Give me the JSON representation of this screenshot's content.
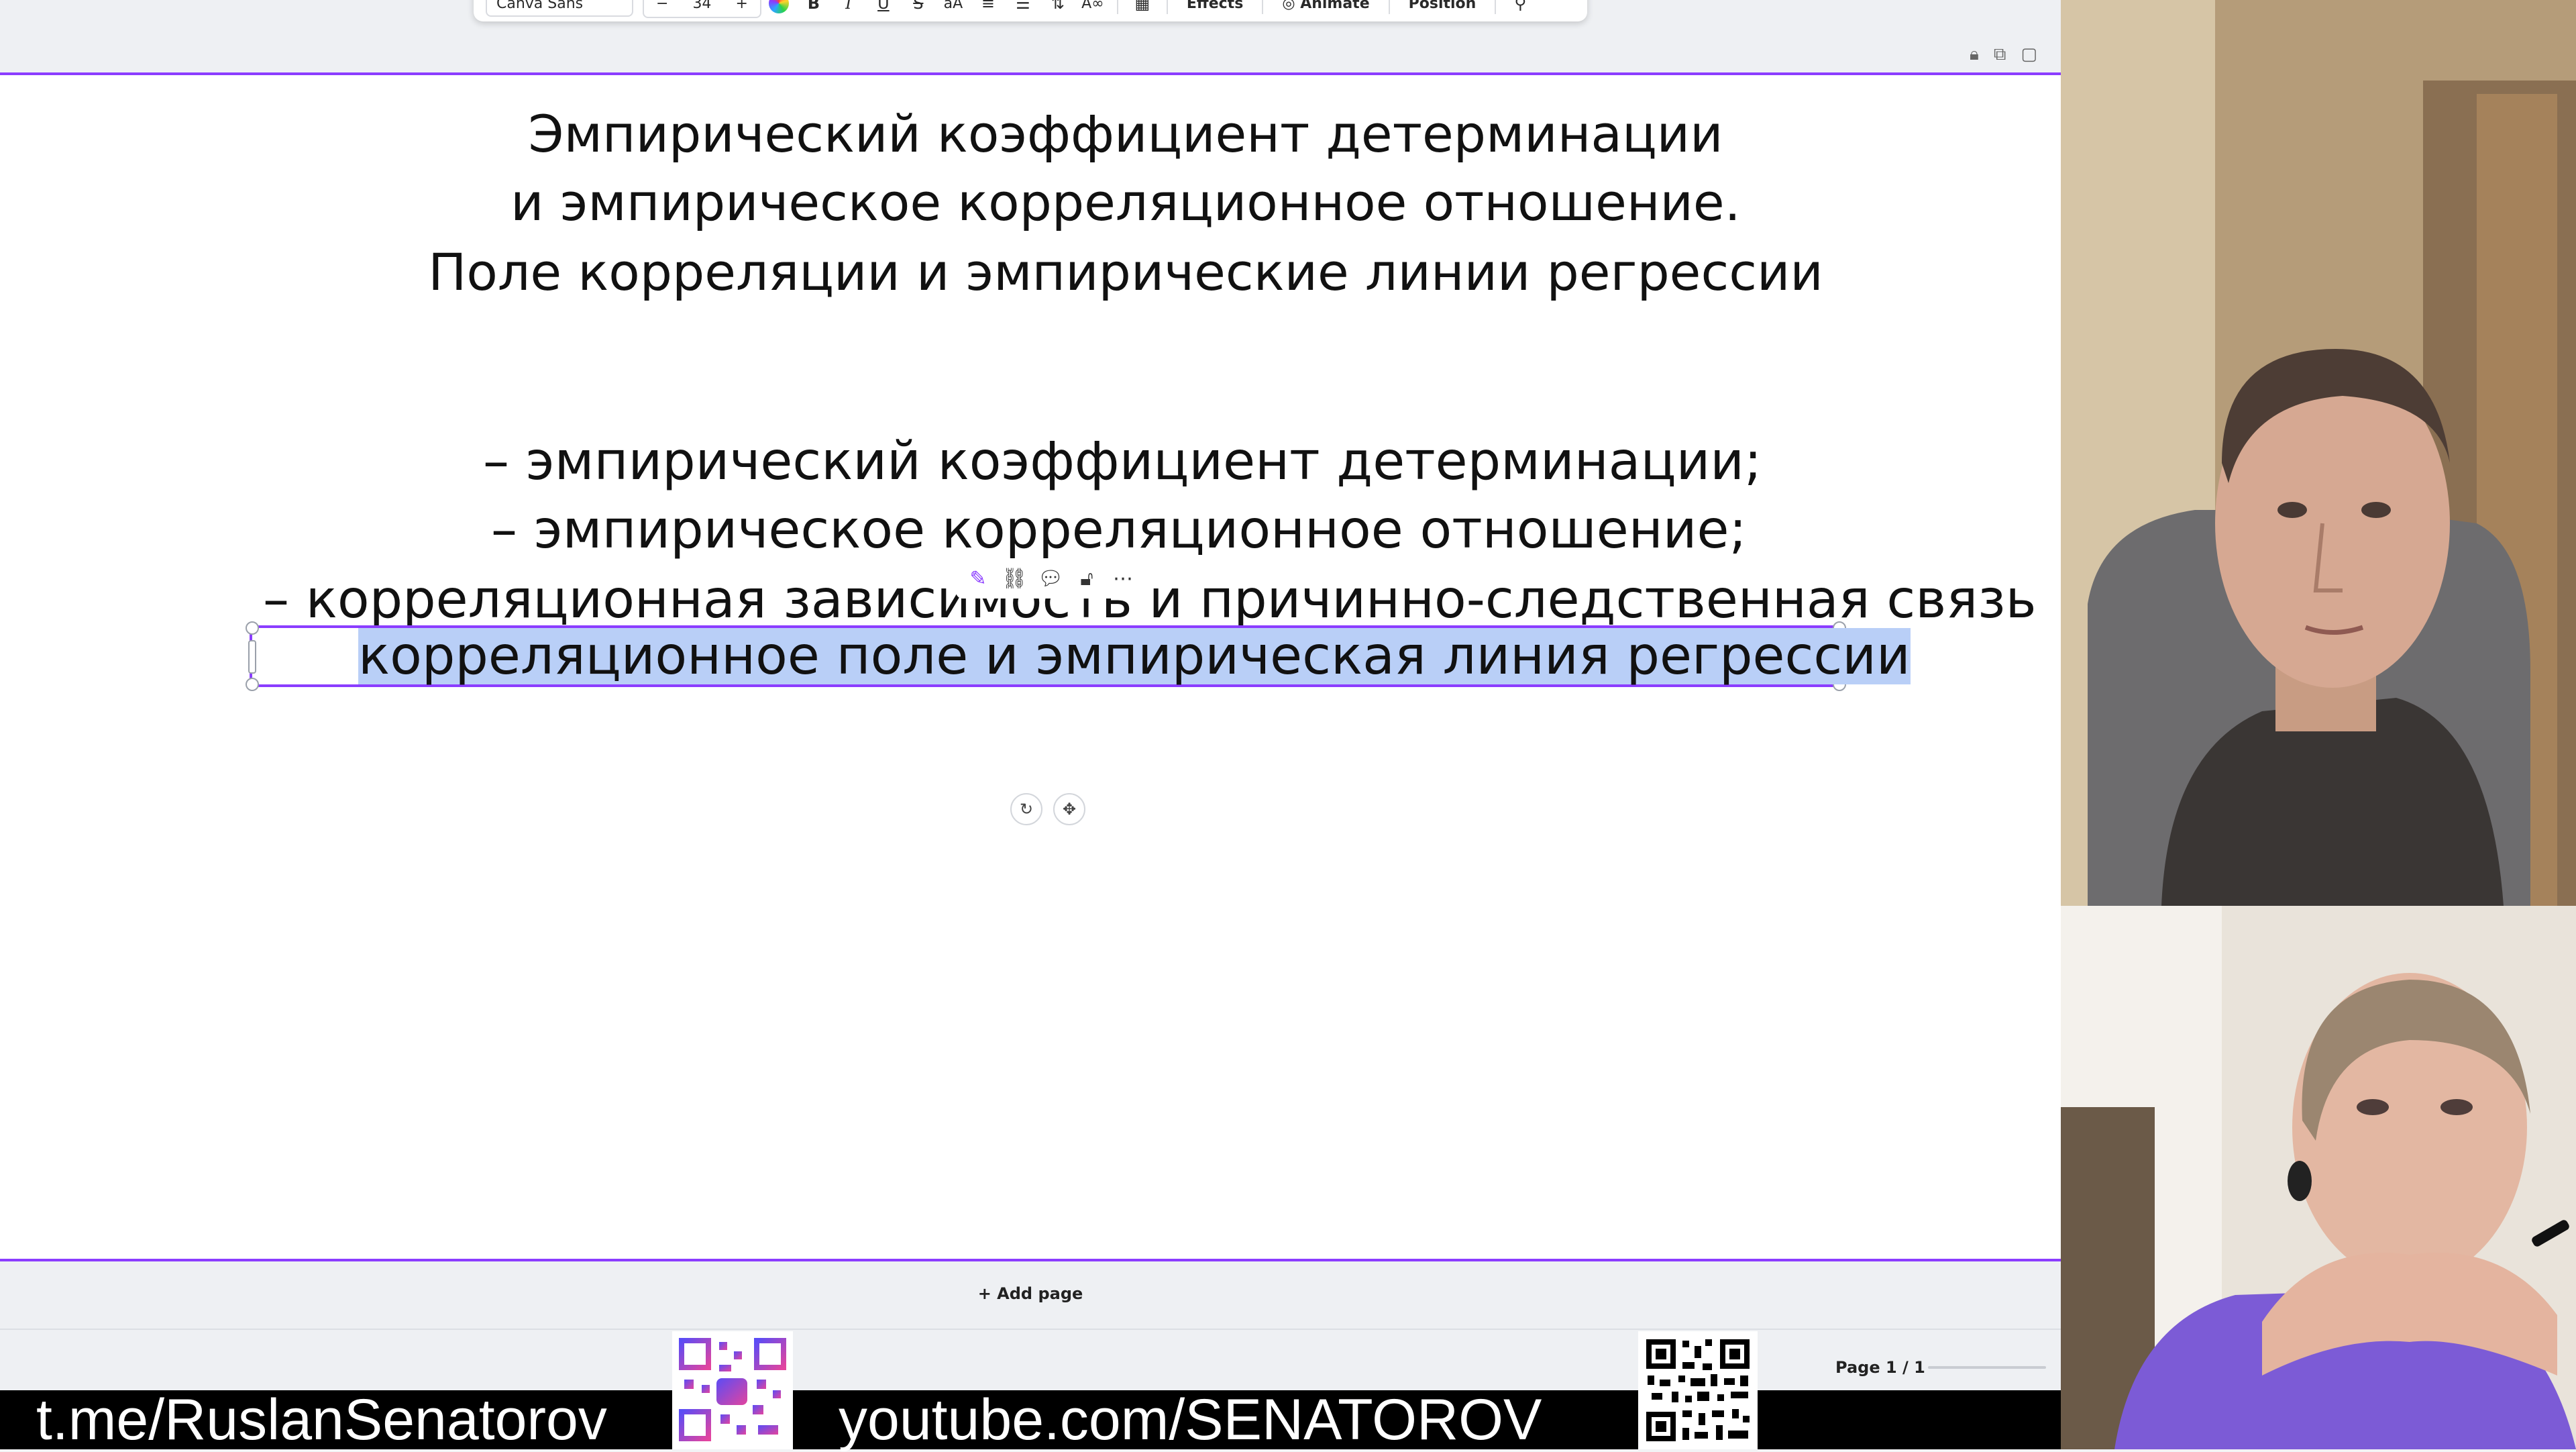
{
  "toolbar": {
    "font_name": "Canva Sans",
    "font_size": "34",
    "decrease": "−",
    "increase": "+",
    "effects_label": "Effects",
    "animate_label": "Animate",
    "position_label": "Position"
  },
  "slide": {
    "title_lines": [
      "Эмпирический коэффициент детерминации",
      "и эмпирическое корреляционное отношение.",
      "Поле корреляции и эмпирические линии регрессии"
    ],
    "body_lines": [
      "– эмпирический коэффициент детерминации;",
      "– эмпирическое корреляционное отношение;",
      "– корреляционная зависимость и причинно-следственная связь"
    ],
    "selected_line": "корреляционное поле и эмпирическая линия регрессии"
  },
  "add_page_label": "+ Add page",
  "page_indicator": "Page 1 / 1",
  "banner": {
    "telegram": "t.me/RuslanSenatorov",
    "youtube": "youtube.com/SENATOROV"
  },
  "colors": {
    "selection": "#8b3dff",
    "highlight": "#b9cff7"
  }
}
